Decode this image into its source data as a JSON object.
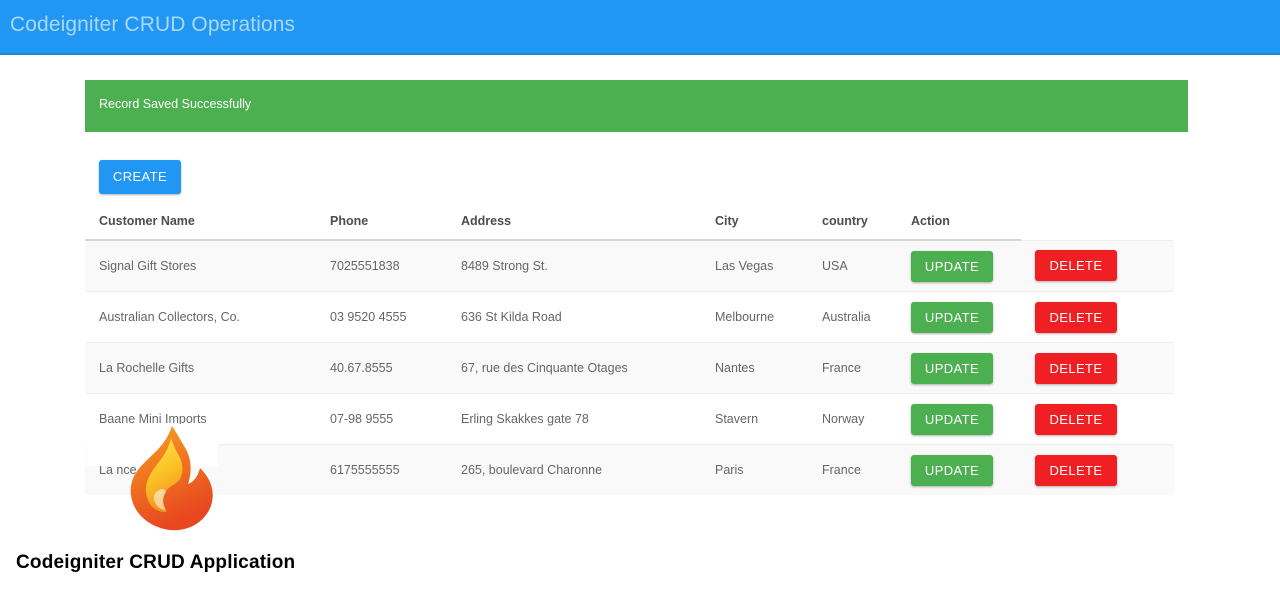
{
  "navbar": {
    "brand": "Codeigniter CRUD Operations",
    "background_color": "#2196F3",
    "text_color": "#a8d9fb"
  },
  "alert": {
    "message": "Record Saved Successfully",
    "type": "success",
    "background_color": "#4CAF50",
    "text_color": "#ffffff"
  },
  "toolbar": {
    "create_label": "CREATE",
    "create_color": "#2196F3"
  },
  "table": {
    "columns": [
      {
        "key": "name",
        "label": "Customer Name"
      },
      {
        "key": "phone",
        "label": "Phone"
      },
      {
        "key": "address",
        "label": "Address"
      },
      {
        "key": "city",
        "label": "City"
      },
      {
        "key": "country",
        "label": "country"
      },
      {
        "key": "action",
        "label": "Action"
      },
      {
        "key": "last",
        "label": ""
      }
    ],
    "update_label": "UPDATE",
    "delete_label": "DELETE",
    "update_color": "#4CAF50",
    "delete_color": "#f01f24",
    "rows": [
      {
        "name": "Signal Gift Stores",
        "phone": "7025551838",
        "address": "8489 Strong St.",
        "city": "Las Vegas",
        "country": "USA"
      },
      {
        "name": "Australian Collectors, Co.",
        "phone": "03 9520 4555",
        "address": "636 St Kilda Road",
        "city": "Melbourne",
        "country": "Australia"
      },
      {
        "name": "La Rochelle Gifts",
        "phone": "40.67.8555",
        "address": "67, rue des Cinquante Otages",
        "city": "Nantes",
        "country": "France"
      },
      {
        "name": "Baane Mini Imports",
        "phone": "07-98 9555",
        "address": "Erling Skakkes gate 78",
        "city": "Stavern",
        "country": "Norway"
      },
      {
        "name": "La                    nce, Co.",
        "phone": "6175555555",
        "address": "265, boulevard Charonne",
        "city": "Paris",
        "country": "France"
      }
    ]
  },
  "footer": {
    "caption": "Codeigniter CRUD Application"
  },
  "logo": {
    "name": "codeigniter-flame-logo"
  }
}
